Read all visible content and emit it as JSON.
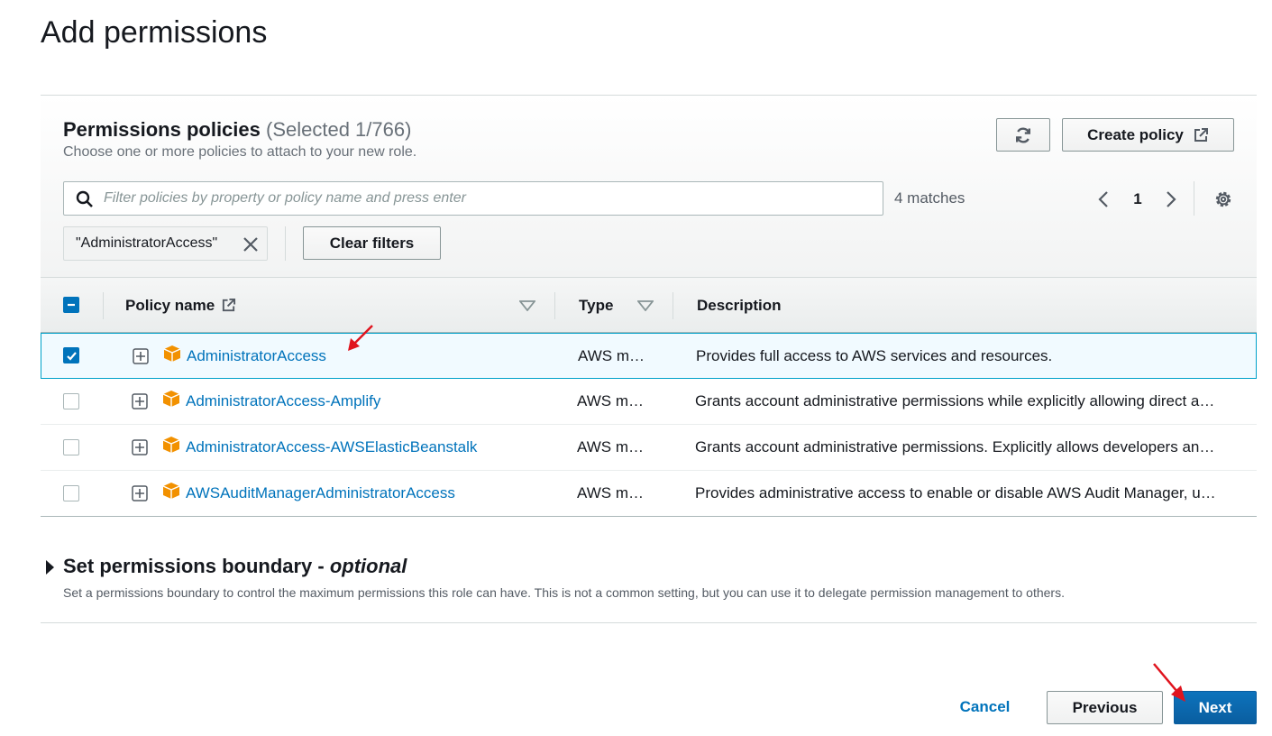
{
  "page": {
    "title": "Add permissions"
  },
  "policies": {
    "title": "Permissions policies",
    "counter": "(Selected 1/766)",
    "description": "Choose one or more policies to attach to your new role.",
    "create_policy_label": "Create policy",
    "search_placeholder": "Filter policies by property or policy name and press enter",
    "matches": "4 matches",
    "current_page": "1",
    "filter_token": "\"AdministratorAccess\"",
    "clear_filters_label": "Clear filters",
    "columns": {
      "policy_name": "Policy name",
      "type": "Type",
      "description": "Description"
    },
    "rows": [
      {
        "name": "AdministratorAccess",
        "type": "AWS m…",
        "description": "Provides full access to AWS services and resources.",
        "checked": true
      },
      {
        "name": "AdministratorAccess-Amplify",
        "type": "AWS m…",
        "description": "Grants account administrative permissions while explicitly allowing direct a…",
        "checked": false
      },
      {
        "name": "AdministratorAccess-AWSElasticBeanstalk",
        "type": "AWS m…",
        "description": "Grants account administrative permissions. Explicitly allows developers an…",
        "checked": false
      },
      {
        "name": "AWSAuditManagerAdministratorAccess",
        "type": "AWS m…",
        "description": "Provides administrative access to enable or disable AWS Audit Manager, u…",
        "checked": false
      }
    ]
  },
  "boundary": {
    "title": "Set permissions boundary - ",
    "title_optional": "optional",
    "description": "Set a permissions boundary to control the maximum permissions this role can have. This is not a common setting, but you can use it to delegate permission management to others."
  },
  "footer": {
    "cancel_label": "Cancel",
    "previous_label": "Previous",
    "next_label": "Next"
  },
  "colors": {
    "link": "#0073bb",
    "primary_button": "#0d73bc",
    "selected_row_bg": "#f1faff",
    "selected_row_border": "#00a1c9",
    "annotation_arrow": "#e0141e",
    "policy_icon": "#f29100"
  },
  "icons": {
    "search": "search-icon",
    "refresh": "refresh-icon",
    "external_link": "external-link-icon",
    "dismiss": "close-icon",
    "pagination_prev": "chevron-left-icon",
    "pagination_next": "chevron-right-icon",
    "settings": "gear-icon",
    "sort": "caret-down-icon",
    "expand": "plus-square-icon",
    "policy": "aws-managed-policy-icon",
    "section_toggle": "caret-right-icon"
  }
}
